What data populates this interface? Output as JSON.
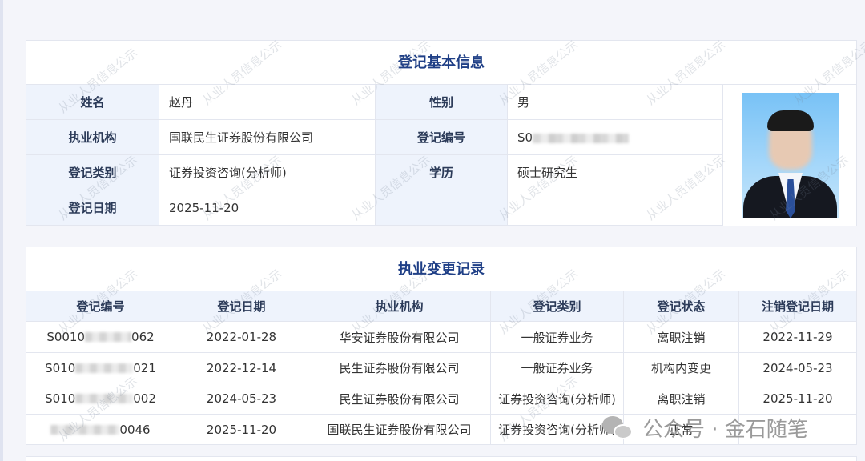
{
  "basic_info": {
    "title": "登记基本信息",
    "rows": [
      [
        {
          "label": "姓名",
          "value": "赵丹"
        },
        {
          "label": "性别",
          "value": "男"
        }
      ],
      [
        {
          "label": "执业机构",
          "value": "国联民生证券股份有限公司"
        },
        {
          "label": "登记编号",
          "value": "S0"
        }
      ],
      [
        {
          "label": "登记类别",
          "value": "证券投资咨询(分析师)"
        },
        {
          "label": "学历",
          "value": "硕士研究生"
        }
      ],
      [
        {
          "label": "登记日期",
          "value": "2025-11-20"
        },
        {
          "label": "",
          "value": ""
        }
      ]
    ]
  },
  "history": {
    "title": "执业变更记录",
    "columns": [
      "登记编号",
      "登记日期",
      "执业机构",
      "登记类别",
      "登记状态",
      "注销登记日期"
    ],
    "rows": [
      [
        "S0010",
        "2022-01-28",
        "华安证券股份有限公司",
        "一般证券业务",
        "离职注销",
        "2022-11-29"
      ],
      [
        "S010",
        "2022-12-14",
        "民生证券股份有限公司",
        "一般证券业务",
        "机构内变更",
        "2024-05-23"
      ],
      [
        "S010",
        "2024-05-23",
        "民生证券股份有限公司",
        "证券投资咨询(分析师)",
        "离职注销",
        "2025-11-20"
      ],
      [
        "0046",
        "2025-11-20",
        "国联民生证券股份有限公司",
        "证券投资咨询(分析师)",
        "正常",
        ""
      ]
    ],
    "reg_suffixes": [
      "062",
      "021",
      "002",
      ""
    ]
  },
  "watermark": "从业人员信息公示",
  "footer_badge": {
    "text": "公众号 · 金石随笔",
    "icon": "wechat-icon"
  }
}
